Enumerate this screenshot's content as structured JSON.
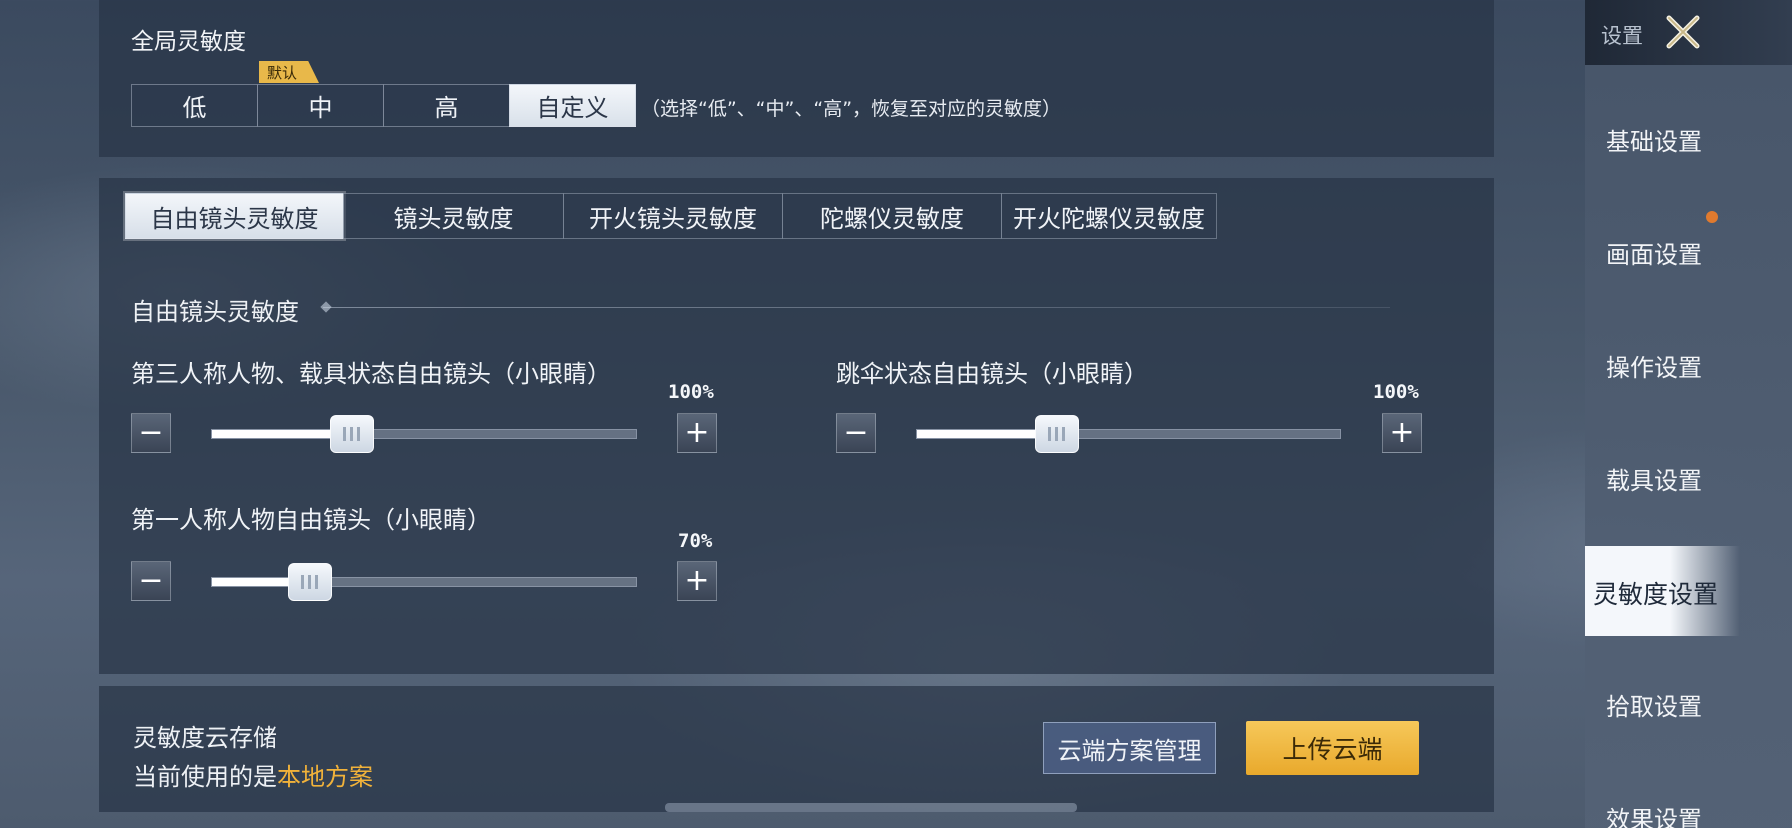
{
  "sidebar": {
    "header_label": "设置",
    "items": [
      {
        "label": "基础设置"
      },
      {
        "label": "画面设置"
      },
      {
        "label": "操作设置"
      },
      {
        "label": "载具设置"
      },
      {
        "label": "灵敏度设置"
      },
      {
        "label": "拾取设置"
      },
      {
        "label": "效果设置"
      }
    ],
    "active_index": 4
  },
  "global_sensitivity": {
    "title": "全局灵敏度",
    "default_badge": "默认",
    "options": [
      "低",
      "中",
      "高",
      "自定义"
    ],
    "selected": "自定义",
    "hint": "（选择“低”、“中”、“高”，恢复至对应的灵敏度）"
  },
  "tabs": {
    "items": [
      "自由镜头灵敏度",
      "镜头灵敏度",
      "开火镜头灵敏度",
      "陀螺仪灵敏度",
      "开火陀螺仪灵敏度"
    ],
    "active_index": 0
  },
  "free_cam": {
    "heading": "自由镜头灵敏度",
    "sliders": [
      {
        "label": "第三人称人物、载具状态自由镜头（小眼睛）",
        "value_text": "100%",
        "fraction": 0.33
      },
      {
        "label": "跳伞状态自由镜头（小眼睛）",
        "value_text": "100%",
        "fraction": 0.33
      },
      {
        "label": "第一人称人物自由镜头（小眼睛）",
        "value_text": "70%",
        "fraction": 0.23
      }
    ]
  },
  "cloud": {
    "title": "灵敏度云存储",
    "current_prefix": "当前使用的是",
    "current_plan": "本地方案",
    "manage_label": "云端方案管理",
    "upload_label": "上传云端"
  },
  "colors": {
    "accent_gold": "#e8b84a",
    "highlight_orange": "#f1b23a",
    "notification_dot": "#e07a2e"
  },
  "icons": {
    "close": "close-x-icon",
    "minus": "minus-icon",
    "plus": "plus-icon"
  }
}
